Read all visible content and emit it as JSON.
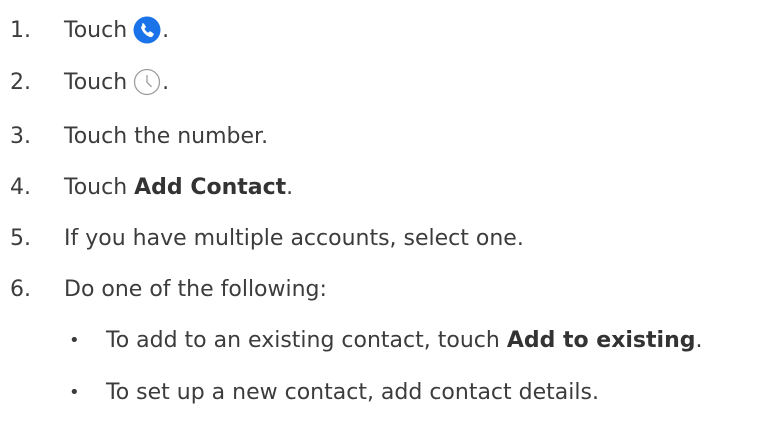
{
  "colors": {
    "text": "#3c3c3c",
    "phone_icon_bg": "#1a73e8",
    "clock_icon_stroke": "#9e9e9e"
  },
  "steps": [
    {
      "number": "1.",
      "before": "Touch",
      "icon": "phone-icon",
      "after": "."
    },
    {
      "number": "2.",
      "before": "Touch",
      "icon": "clock-icon",
      "after": "."
    },
    {
      "number": "3.",
      "text": "Touch the number."
    },
    {
      "number": "4.",
      "before": "Touch ",
      "bold": "Add Contact",
      "after": "."
    },
    {
      "number": "5.",
      "text": "If you have multiple accounts, select one."
    },
    {
      "number": "6.",
      "text": "Do one of the following:"
    }
  ],
  "sub_steps": [
    {
      "bullet": "•",
      "before": "To add to an existing contact, touch ",
      "bold": "Add to existing",
      "after": "."
    },
    {
      "bullet": "•",
      "text": "To set up a new contact, add contact details."
    }
  ]
}
